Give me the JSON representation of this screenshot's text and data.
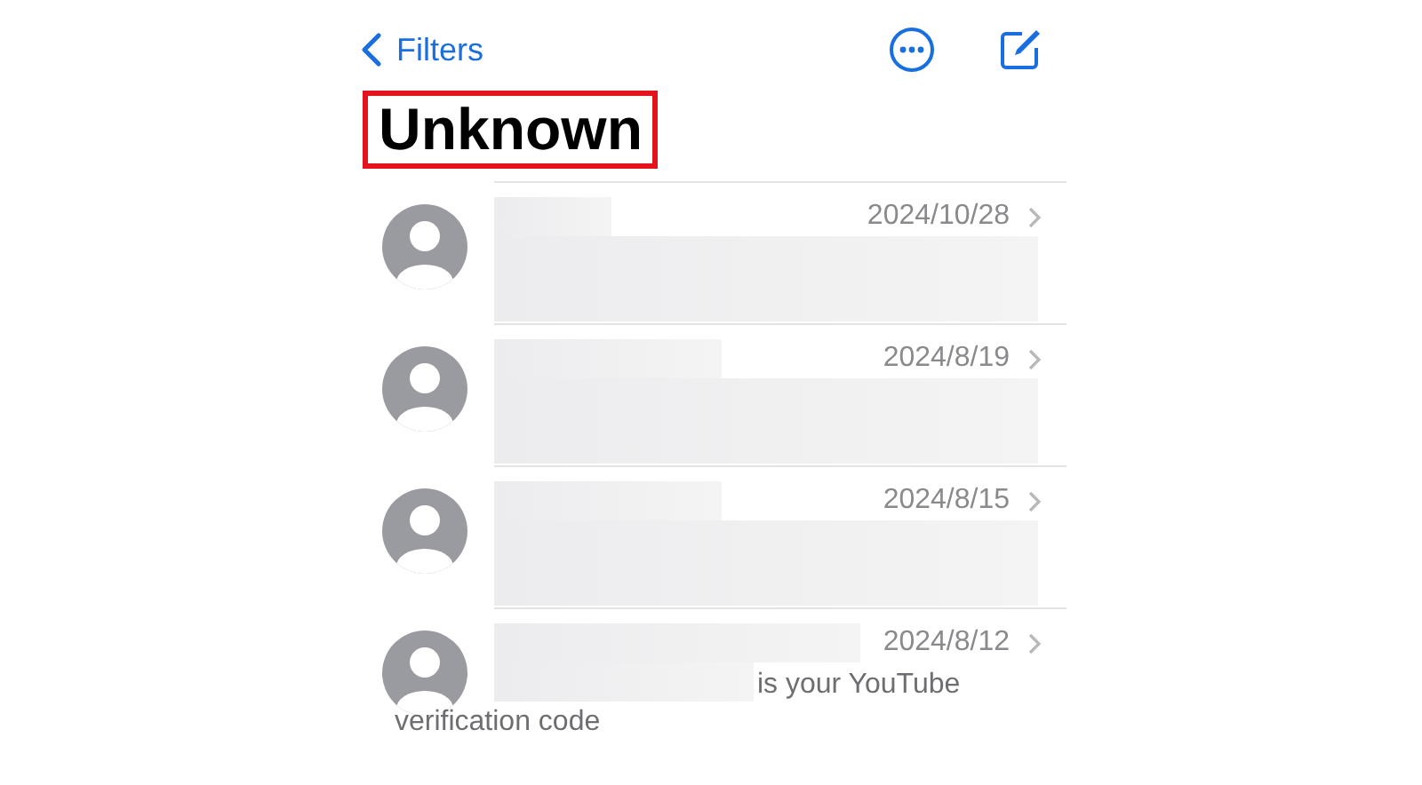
{
  "nav": {
    "back_label": "Filters"
  },
  "title": {
    "text": "Unknown",
    "highlighted": true
  },
  "conversations": [
    {
      "date": "2024/10/28"
    },
    {
      "date": "2024/8/19"
    },
    {
      "date": "2024/8/15"
    },
    {
      "date": "2024/8/12",
      "preview": "is your YouTube",
      "preview_continued": "verification code"
    }
  ]
}
